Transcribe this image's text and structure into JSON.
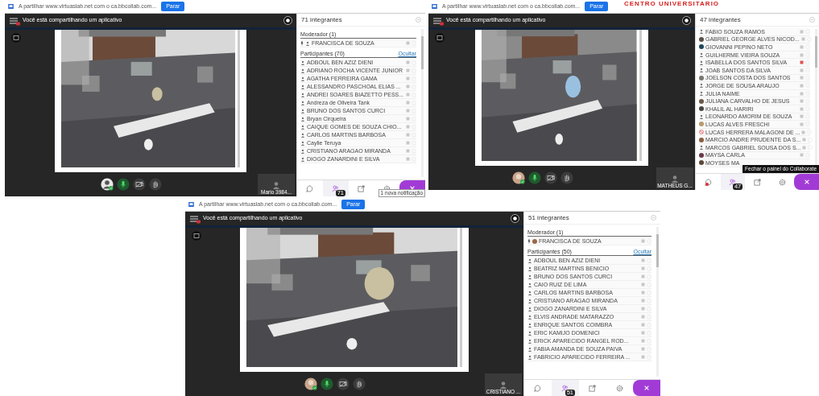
{
  "header_title": "CENTRO UNIVERSITARIO",
  "sessions": [
    {
      "share_text": "A partilhar www.virtuaslab.net com o ca.bbcollab.com...",
      "stop_button": "Parar",
      "banner": "Você está compartilhando um aplicativo",
      "tile_name": "Mario 3984...",
      "panel_title": "71 integrantes",
      "tooltip": {
        "text": "1 nova notificação",
        "kind": "notification"
      },
      "controls": [
        {
          "kind": "avatar",
          "photo": false
        },
        {
          "kind": "mic",
          "on": true
        },
        {
          "kind": "camera"
        },
        {
          "kind": "hand"
        }
      ],
      "sections": [
        {
          "title": "Moderador (1)",
          "members": [
            {
              "name": "FRANCISCA DE SOUZA",
              "kind": "person",
              "speaking": true
            }
          ]
        },
        {
          "title": "Participantes (70)",
          "action": "Ocultar",
          "members": [
            {
              "name": "ADBOUL BEN AZIZ DIENI",
              "kind": "person"
            },
            {
              "name": "ADRIANO ROCHA VICENTE JUNIOR",
              "kind": "person"
            },
            {
              "name": "AGATHA FERREIRA GAMA",
              "kind": "person"
            },
            {
              "name": "ALESSANDRO PASCHOAL ELIAS ...",
              "kind": "person"
            },
            {
              "name": "ANDREI SOARES BIAZETTO PESS...",
              "kind": "person"
            },
            {
              "name": "Andreza de Oliveira Tank",
              "kind": "person"
            },
            {
              "name": "BRUNO DOS SANTOS CURCI",
              "kind": "person"
            },
            {
              "name": "Bryan Cirqueira",
              "kind": "person"
            },
            {
              "name": "CAIQUE GOMES DE SOUZA CHIO...",
              "kind": "person"
            },
            {
              "name": "CARLOS MARTINS BARBOSA",
              "kind": "person"
            },
            {
              "name": "Caylie Teruya",
              "kind": "person"
            },
            {
              "name": "CRISTIANO ARAGAO MIRANDA",
              "kind": "person"
            },
            {
              "name": "DIOGO ZANARDINI E SILVA",
              "kind": "person"
            }
          ]
        }
      ],
      "tabs": [
        {
          "kind": "chat",
          "selected": false,
          "notification": false
        },
        {
          "kind": "people",
          "selected": true,
          "badge": "71"
        },
        {
          "kind": "share",
          "selected": false
        },
        {
          "kind": "settings",
          "selected": false
        },
        {
          "kind": "close"
        }
      ]
    },
    {
      "share_text": "A partilhar www.virtuaslab.net com o ca.bbcollab.com...",
      "stop_button": "Parar",
      "banner": "Você está compartilhando um aplicativo",
      "tile_name": "MATHEUS G...",
      "panel_title": "47 integrantes",
      "tooltip": {
        "text": "Fechar o painel do Collaborate",
        "kind": "hint"
      },
      "controls": [
        {
          "kind": "avatar",
          "photo": true
        },
        {
          "kind": "mic",
          "on": true
        },
        {
          "kind": "camera"
        },
        {
          "kind": "hand"
        }
      ],
      "sections": [
        {
          "members": [
            {
              "name": "FABIO SOUZA RAMOS",
              "kind": "person"
            },
            {
              "name": "GABRIEL GEORGE ALVES NICOD...",
              "color": "#5a5048"
            },
            {
              "name": "GIOVANNI PEPINO NETO",
              "color": "#1e4a5a"
            },
            {
              "name": "GUILHERME VIEIRA SOUZA",
              "kind": "person"
            },
            {
              "name": "ISABELLA DOS SANTOS SILVA",
              "kind": "person",
              "mic_alert": true
            },
            {
              "name": "JOAB SANTOS DA SILVA",
              "kind": "person"
            },
            {
              "name": "JOELSON COSTA DOS SANTOS",
              "color": "#7a7670"
            },
            {
              "name": "JORGE DE SOUSA ARAUJO",
              "kind": "person"
            },
            {
              "name": "JULIA NAIME",
              "kind": "person"
            },
            {
              "name": "JULIANA CARVALHO DE JESUS",
              "color": "#6a5a4a"
            },
            {
              "name": "KHALIL AL HARIRI",
              "color": "#4a4440"
            },
            {
              "name": "LEONARDO AMORIM DE SOUZA",
              "kind": "person"
            },
            {
              "name": "LUCAS ALVES FRESCHI",
              "color": "#b89a6a"
            },
            {
              "name": "LUCAS HERRERA MALAGONI DE ...",
              "kind": "blocked"
            },
            {
              "name": "MARCIO ANDRE PRUDENTE DA S...",
              "color": "#8a6040"
            },
            {
              "name": "MARCOS GABRIEL SOUSA DOS S...",
              "kind": "person"
            },
            {
              "name": "MAYSA CARLA",
              "color": "#6a3a4a"
            },
            {
              "name": "MOYSES MA",
              "color": "#5a4a3a",
              "icons": false
            }
          ]
        }
      ],
      "tabs": [
        {
          "kind": "chat",
          "selected": false,
          "notification": true
        },
        {
          "kind": "people",
          "selected": true,
          "badge": "47"
        },
        {
          "kind": "share",
          "selected": false
        },
        {
          "kind": "settings",
          "selected": false
        },
        {
          "kind": "close"
        }
      ]
    },
    {
      "share_text": "A partilhar www.virtuaslab.net com o ca.bbcollab.com...",
      "stop_button": "Parar",
      "banner": "Você está compartilhando um aplicativo",
      "tile_name": "CRISTIANO ...",
      "panel_title": "51 integrantes",
      "controls": [
        {
          "kind": "avatar",
          "photo": true
        },
        {
          "kind": "mic",
          "on": true
        },
        {
          "kind": "camera"
        },
        {
          "kind": "hand"
        }
      ],
      "sections": [
        {
          "title": "Moderador (1)",
          "members": [
            {
              "name": "FRANCISCA DE SOUZA",
              "color": "#9a6a4a",
              "speaking": true
            }
          ]
        },
        {
          "title": "Participantes (50)",
          "action": "Ocultar",
          "members": [
            {
              "name": "ADBOUL BEN AZIZ DIENI",
              "kind": "person"
            },
            {
              "name": "BEATRIZ MARTINS BENICIO",
              "kind": "person"
            },
            {
              "name": "BRUNO DOS SANTOS CURCI",
              "kind": "person"
            },
            {
              "name": "CAIO RUIZ DE LIMA",
              "kind": "person"
            },
            {
              "name": "CARLOS MARTINS BARBOSA",
              "kind": "person"
            },
            {
              "name": "CRISTIANO ARAGAO MIRANDA",
              "kind": "person"
            },
            {
              "name": "DIOGO ZANARDINI E SILVA",
              "kind": "person"
            },
            {
              "name": "ELVIS ANDRADE MATARAZZO",
              "kind": "person"
            },
            {
              "name": "ENRIQUE SANTOS COIMBRA",
              "kind": "person"
            },
            {
              "name": "ERIC KAMIJO DOMENICI",
              "kind": "person"
            },
            {
              "name": "ERICK APARECIDO RANGEL ROD...",
              "kind": "person"
            },
            {
              "name": "FABIA AMANDA DE SOUZA PAIVA",
              "kind": "person"
            },
            {
              "name": "FABRICIO APARECIDO FERREIRA ...",
              "kind": "person"
            }
          ]
        }
      ],
      "tabs": [
        {
          "kind": "chat",
          "selected": false,
          "notification": false
        },
        {
          "kind": "people",
          "selected": true,
          "badge": "51"
        },
        {
          "kind": "share",
          "selected": false
        },
        {
          "kind": "settings",
          "selected": false
        },
        {
          "kind": "close"
        }
      ]
    }
  ]
}
